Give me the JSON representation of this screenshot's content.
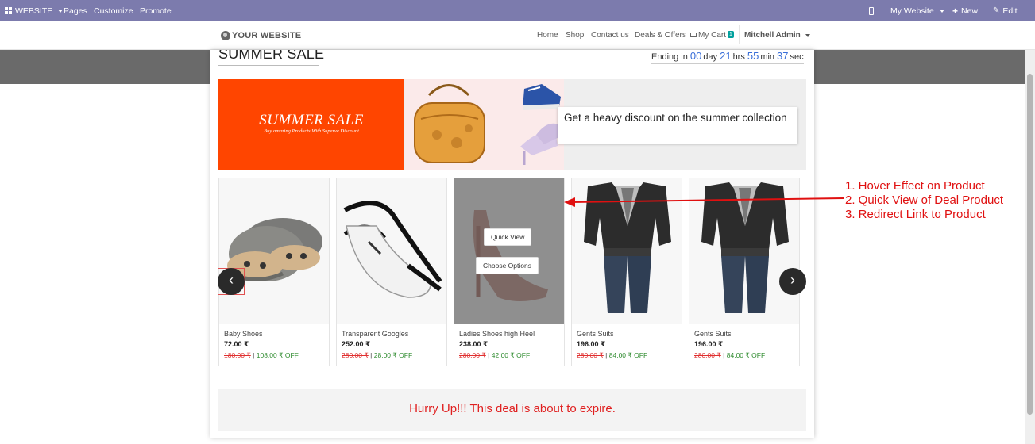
{
  "admin_bar": {
    "website_label": "WEBSITE",
    "pages_label": "Pages",
    "customize_label": "Customize",
    "promote_label": "Promote",
    "my_website_label": "My Website",
    "new_label": "New",
    "edit_label": "Edit"
  },
  "site_nav": {
    "logo_text": "YOUR WEBSITE",
    "links": [
      "Home",
      "Shop",
      "Contact us",
      "Deals & Offers"
    ],
    "cart_label": "My Cart",
    "cart_count": "1",
    "user_label": "Mitchell Admin"
  },
  "deal": {
    "title": "SUMMER SALE",
    "countdown": {
      "prefix": "Ending in",
      "days": "00",
      "days_unit": "day",
      "hours": "21",
      "hours_unit": "hrs",
      "minutes": "55",
      "minutes_unit": "min",
      "seconds": "37",
      "seconds_unit": "sec"
    },
    "banner": {
      "headline": "SUMMER SALE",
      "tagline": "Buy amazing Products With Superve Discount",
      "callout": "Get a heavy discount on the summer collection"
    },
    "products": [
      {
        "name": "Baby Shoes",
        "price": "72.00 ₹",
        "old_price": "180.00 ₹",
        "separator": "|",
        "discount": "108.00 ₹ OFF"
      },
      {
        "name": "Transparent Googles",
        "price": "252.00 ₹",
        "old_price": "280.00 ₹",
        "separator": "|",
        "discount": "28.00 ₹ OFF"
      },
      {
        "name": "Ladies Shoes high Heel",
        "price": "238.00 ₹",
        "old_price": "280.00 ₹",
        "separator": "|",
        "discount": "42.00 ₹ OFF"
      },
      {
        "name": "Gents Suits",
        "price": "196.00 ₹",
        "old_price": "280.00 ₹",
        "separator": "|",
        "discount": "84.00 ₹ OFF"
      },
      {
        "name": "Gents Suits",
        "price": "196.00 ₹",
        "old_price": "280.00 ₹",
        "separator": "|",
        "discount": "84.00 ₹ OFF"
      }
    ],
    "quick_view_label": "Quick View",
    "choose_options_label": "Choose Options",
    "prev_label": "‹",
    "next_label": "›",
    "hurry_text": "Hurry Up!!! This deal is about to expire."
  },
  "annotation": {
    "lines": [
      "1. Hover Effect on Product",
      "2. Quick View of Deal Product",
      "3. Redirect Link to Product"
    ],
    "color": "#e01010"
  },
  "colors": {
    "admin_bar": "#7c7bad",
    "banner_red": "#ff4500",
    "countdown_number": "#3a6fd8",
    "discount_green": "#2e8b2e",
    "strike_red": "#e03030",
    "cart_badge": "#00a09d"
  }
}
